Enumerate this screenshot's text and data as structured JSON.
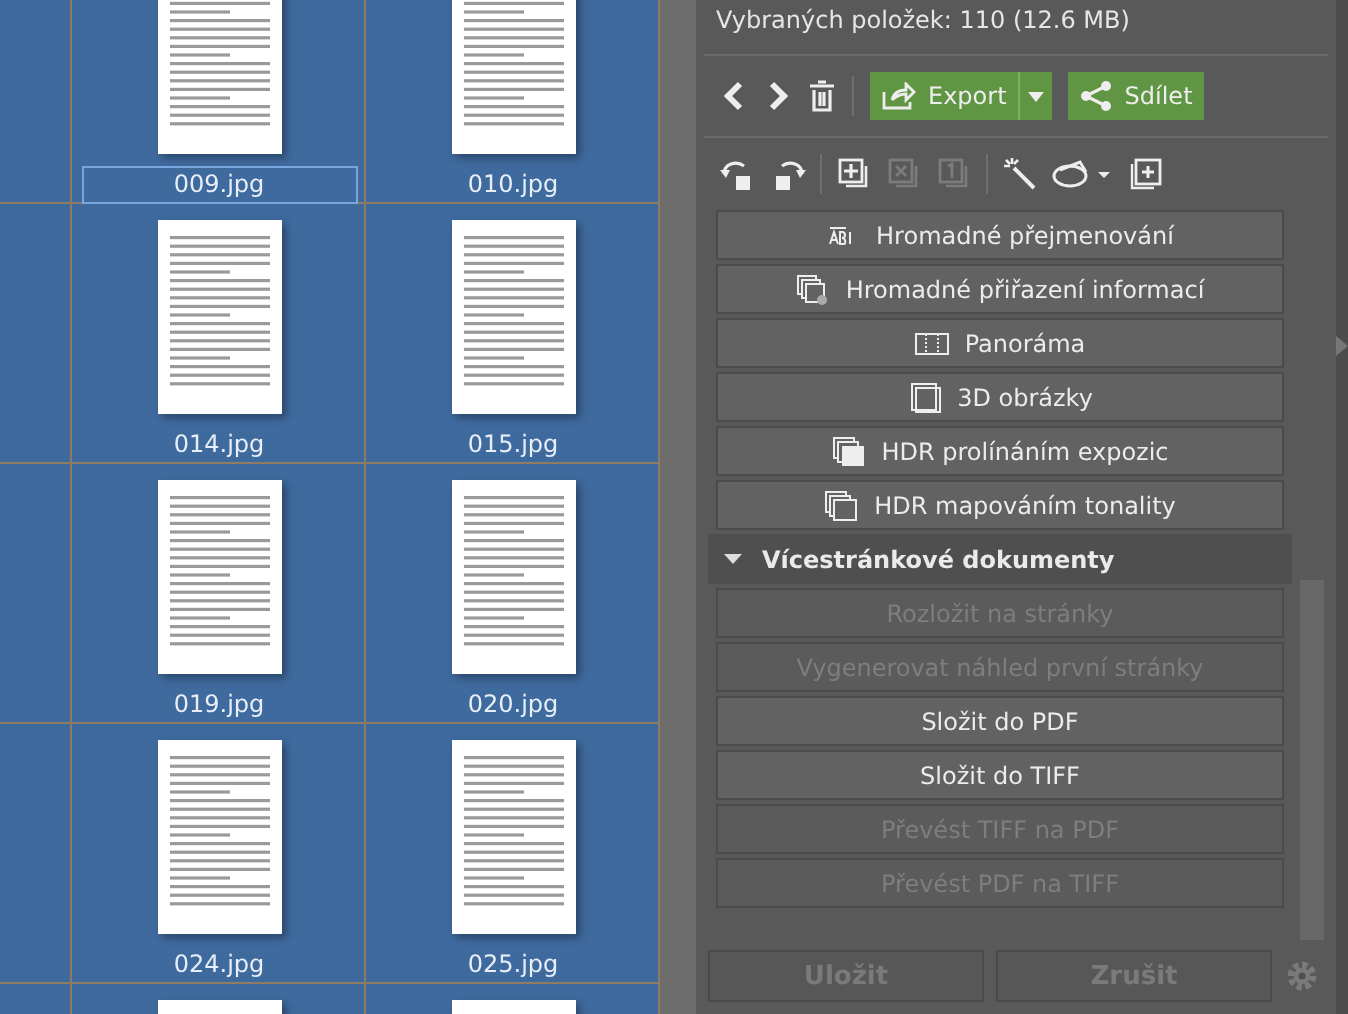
{
  "thumbnails": [
    {
      "name": "009.jpg",
      "selected": true
    },
    {
      "name": "010.jpg",
      "selected": false
    },
    {
      "name": "014.jpg",
      "selected": false
    },
    {
      "name": "015.jpg",
      "selected": false
    },
    {
      "name": "019.jpg",
      "selected": false
    },
    {
      "name": "020.jpg",
      "selected": false
    },
    {
      "name": "024.jpg",
      "selected": false
    },
    {
      "name": "025.jpg",
      "selected": false
    }
  ],
  "summary": "Vybraných položek: 110 (12.6 MB)",
  "toolbar": {
    "export": "Export",
    "share": "Sdílet"
  },
  "tools": [
    {
      "kind": "rotate-left",
      "disabled": false
    },
    {
      "kind": "rotate-right",
      "disabled": false
    },
    {
      "kind": "sep"
    },
    {
      "kind": "add-copy",
      "disabled": false
    },
    {
      "kind": "remove-copy",
      "disabled": true
    },
    {
      "kind": "one-copy",
      "disabled": true
    },
    {
      "kind": "sep"
    },
    {
      "kind": "wand",
      "disabled": false
    },
    {
      "kind": "layers",
      "disabled": false
    },
    {
      "kind": "add-page",
      "disabled": false
    }
  ],
  "tool_buttons": [
    {
      "kind": "rename",
      "label": "Hromadné přejmenování"
    },
    {
      "kind": "info",
      "label": "Hromadné přiřazení informací"
    },
    {
      "kind": "panorama",
      "label": "Panoráma"
    },
    {
      "kind": "cube",
      "label": "3D obrázky"
    },
    {
      "kind": "hdr-blend",
      "label": "HDR prolínáním expozic"
    },
    {
      "kind": "hdr-tone",
      "label": "HDR mapováním tonality"
    }
  ],
  "section": {
    "title": "Vícestránkové dokumenty",
    "expanded": true,
    "buttons": [
      {
        "label": "Rozložit na stránky",
        "disabled": true
      },
      {
        "label": "Vygenerovat náhled první stránky",
        "disabled": true
      },
      {
        "label": "Složit do PDF",
        "disabled": false
      },
      {
        "label": "Složit do TIFF",
        "disabled": false
      },
      {
        "label": "Převést TIFF na PDF",
        "disabled": true
      },
      {
        "label": "Převést PDF na TIFF",
        "disabled": true
      }
    ]
  },
  "footer": {
    "save": {
      "label": "Uložit",
      "disabled": true
    },
    "cancel": {
      "label": "Zrušit",
      "disabled": true
    }
  }
}
